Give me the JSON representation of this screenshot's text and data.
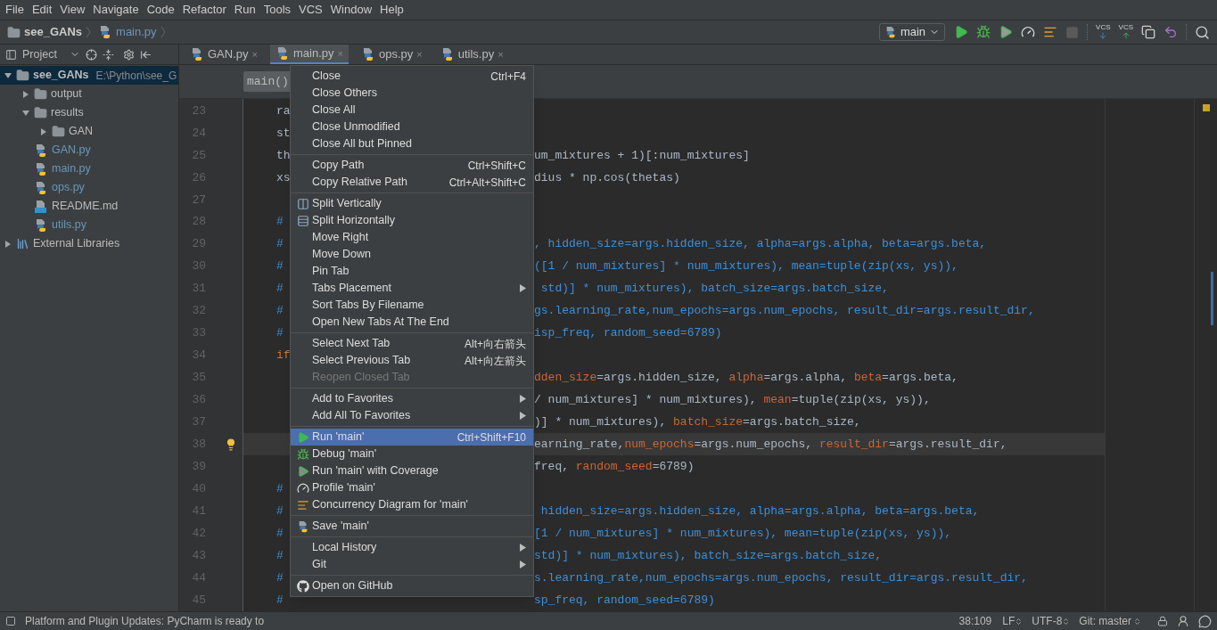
{
  "menu_bar": [
    "File",
    "Edit",
    "View",
    "Navigate",
    "Code",
    "Refactor",
    "Run",
    "Tools",
    "VCS",
    "Window",
    "Help"
  ],
  "breadcrumb": [
    {
      "label": "see_GANs",
      "kind": "folder"
    },
    {
      "label": "main.py",
      "kind": "python"
    }
  ],
  "toolbar": {
    "run_config": "main",
    "vcs_update_label": "VCS",
    "vcs_commit_label": "VCS",
    "stop_disabled": true
  },
  "project_panel": {
    "title": "Project",
    "tree": [
      {
        "label": "see_GANs",
        "path": "E:\\Python\\see_G",
        "kind": "folder",
        "expanded": true,
        "selected": true,
        "children": [
          {
            "label": "output",
            "kind": "folder",
            "expanded": false,
            "selected": false
          },
          {
            "label": "results",
            "kind": "folder",
            "expanded": true,
            "selected": false,
            "children": [
              {
                "label": "GAN",
                "kind": "folder",
                "expanded": false,
                "selected": false
              }
            ]
          },
          {
            "label": "GAN.py",
            "kind": "python",
            "selected": false
          },
          {
            "label": "main.py",
            "kind": "python",
            "selected": false
          },
          {
            "label": "ops.py",
            "kind": "python",
            "selected": false
          },
          {
            "label": "README.md",
            "kind": "markdown",
            "selected": false
          },
          {
            "label": "utils.py",
            "kind": "python",
            "selected": false
          }
        ]
      },
      {
        "label": "External Libraries",
        "kind": "library",
        "expanded": false,
        "selected": false
      }
    ]
  },
  "editor_tabs": [
    {
      "label": "GAN.py",
      "close": "×",
      "selected": false
    },
    {
      "label": "main.py",
      "close": "×",
      "selected": true
    },
    {
      "label": "ops.py",
      "close": "×",
      "selected": false
    },
    {
      "label": "utils.py",
      "close": "×",
      "selected": false
    }
  ],
  "editor_breadcrumb": "main()",
  "code_lines": [
    {
      "number": "23",
      "left": "ra",
      "kind": "code",
      "current": false
    },
    {
      "number": "24",
      "left": "st",
      "kind": "code",
      "current": false
    },
    {
      "number": "25",
      "left": "th",
      "kind": "code",
      "current": false,
      "right": [
        {
          "text": "um_mixtures + 1)[:num_mixtures]",
          "kind": "plain"
        }
      ]
    },
    {
      "number": "26",
      "left": "xs",
      "kind": "code",
      "current": false,
      "right": [
        {
          "text": "dius * np.cos(thetas)",
          "kind": "plain"
        }
      ]
    },
    {
      "number": "27",
      "kind": "code",
      "current": false
    },
    {
      "number": "28",
      "left": "#",
      "kind": "comment",
      "current": false
    },
    {
      "number": "29",
      "left": "#",
      "kind": "comment",
      "current": false,
      "right": [
        {
          "text": ", hidden_size=args.hidden_size, alpha=args.alpha, beta=args.beta,"
        }
      ]
    },
    {
      "number": "30",
      "left": "#",
      "kind": "comment",
      "current": false,
      "right": [
        {
          "text": "([1 / num_mixtures] * num_mixtures), mean=tuple(zip(xs, ys)),"
        }
      ]
    },
    {
      "number": "31",
      "left": "#",
      "kind": "comment",
      "current": false,
      "right": [
        {
          "text": " std)] * num_mixtures), batch_size=args.batch_size,"
        }
      ]
    },
    {
      "number": "32",
      "left": "#",
      "kind": "comment",
      "current": false,
      "right": [
        {
          "text": "gs.learning_rate,num_epochs=args.num_epochs, result_dir=args.result_dir,"
        }
      ]
    },
    {
      "number": "33",
      "left": "#",
      "kind": "comment",
      "current": false,
      "right": [
        {
          "text": "isp_freq, random_seed=6789)"
        }
      ]
    },
    {
      "number": "34",
      "left": "if",
      "kind": "keyword",
      "current": false
    },
    {
      "number": "35",
      "kind": "code",
      "current": false,
      "right": [
        {
          "text": "dden_size",
          "kind": "param"
        },
        {
          "text": "=args.hidden_size, ",
          "kind": "plain"
        },
        {
          "text": "alpha",
          "kind": "param"
        },
        {
          "text": "=args.alpha, ",
          "kind": "plain"
        },
        {
          "text": "beta",
          "kind": "param"
        },
        {
          "text": "=args.beta,",
          "kind": "plain"
        }
      ]
    },
    {
      "number": "36",
      "kind": "code",
      "current": false,
      "right": [
        {
          "text": "/ num_mixtures] * num_mixtures), ",
          "kind": "plain"
        },
        {
          "text": "mean",
          "kind": "param"
        },
        {
          "text": "=tuple(zip(xs, ys)),",
          "kind": "plain"
        }
      ]
    },
    {
      "number": "37",
      "kind": "code",
      "current": false,
      "right": [
        {
          "text": ")] * num_mixtures), ",
          "kind": "plain"
        },
        {
          "text": "batch_size",
          "kind": "param"
        },
        {
          "text": "=args.batch_size,",
          "kind": "plain"
        }
      ]
    },
    {
      "number": "38",
      "kind": "code",
      "current": true,
      "right": [
        {
          "text": "earning_rate,",
          "kind": "plain"
        },
        {
          "text": "num_epochs",
          "kind": "param"
        },
        {
          "text": "=args.num_epochs, ",
          "kind": "plain"
        },
        {
          "text": "result_dir",
          "kind": "param"
        },
        {
          "text": "=args.result_dir,",
          "kind": "plain"
        }
      ]
    },
    {
      "number": "39",
      "kind": "code",
      "current": false,
      "right": [
        {
          "text": "freq, ",
          "kind": "plain"
        },
        {
          "text": "random_seed",
          "kind": "param"
        },
        {
          "text": "=6789)",
          "kind": "plain"
        }
      ]
    },
    {
      "number": "40",
      "left": "#",
      "kind": "comment",
      "current": false
    },
    {
      "number": "41",
      "left": "#",
      "kind": "comment",
      "current": false,
      "right": [
        {
          "text": " hidden_size=args.hidden_size, alpha=args.alpha, beta=args.beta,"
        }
      ]
    },
    {
      "number": "42",
      "left": "#",
      "kind": "comment",
      "current": false,
      "right": [
        {
          "text": "[1 / num_mixtures] * num_mixtures), mean=tuple(zip(xs, ys)),"
        }
      ]
    },
    {
      "number": "43",
      "left": "#",
      "kind": "comment",
      "current": false,
      "right": [
        {
          "text": "std)] * num_mixtures), batch_size=args.batch_size,"
        }
      ]
    },
    {
      "number": "44",
      "left": "#",
      "kind": "comment",
      "current": false,
      "right": [
        {
          "text": "s.learning_rate,num_epochs=args.num_epochs, result_dir=args.result_dir,"
        }
      ]
    },
    {
      "number": "45",
      "left": "#",
      "kind": "comment",
      "current": false,
      "right": [
        {
          "text": "sp_freq, random_seed=6789)"
        }
      ]
    }
  ],
  "context_menu": [
    {
      "kind": "item",
      "label": "Close",
      "shortcut": "Ctrl+F4",
      "submenu": false,
      "disabled": false,
      "selected": false
    },
    {
      "kind": "item",
      "label": "Close Others",
      "submenu": false,
      "disabled": false,
      "selected": false
    },
    {
      "kind": "item",
      "label": "Close All",
      "submenu": false,
      "disabled": false,
      "selected": false
    },
    {
      "kind": "item",
      "label": "Close Unmodified",
      "submenu": false,
      "disabled": false,
      "selected": false
    },
    {
      "kind": "item",
      "label": "Close All but Pinned",
      "submenu": false,
      "disabled": false,
      "selected": false
    },
    {
      "kind": "separator"
    },
    {
      "kind": "item",
      "label": "Copy Path",
      "shortcut": "Ctrl+Shift+C",
      "submenu": false,
      "disabled": false,
      "selected": false
    },
    {
      "kind": "item",
      "label": "Copy Relative Path",
      "shortcut": "Ctrl+Alt+Shift+C",
      "submenu": false,
      "disabled": false,
      "selected": false
    },
    {
      "kind": "separator"
    },
    {
      "kind": "splitvertical",
      "label": "Split Vertically",
      "submenu": false,
      "disabled": false,
      "selected": false
    },
    {
      "kind": "splithorizontal",
      "label": "Split Horizontally",
      "submenu": false,
      "disabled": false,
      "selected": false
    },
    {
      "kind": "item",
      "label": "Move Right",
      "submenu": false,
      "disabled": false,
      "selected": false
    },
    {
      "kind": "item",
      "label": "Move Down",
      "submenu": false,
      "disabled": false,
      "selected": false
    },
    {
      "kind": "item",
      "label": "Pin Tab",
      "submenu": false,
      "disabled": false,
      "selected": false
    },
    {
      "kind": "item",
      "label": "Tabs Placement",
      "submenu": true,
      "disabled": false,
      "selected": false
    },
    {
      "kind": "item",
      "label": "Sort Tabs By Filename",
      "submenu": false,
      "disabled": false,
      "selected": false
    },
    {
      "kind": "item",
      "label": "Open New Tabs At The End",
      "submenu": false,
      "disabled": false,
      "selected": false
    },
    {
      "kind": "separator"
    },
    {
      "kind": "item",
      "label": "Select Next Tab",
      "shortcut": "Alt+向右箭头",
      "submenu": false,
      "disabled": false,
      "selected": false
    },
    {
      "kind": "item",
      "label": "Select Previous Tab",
      "shortcut": "Alt+向左箭头",
      "submenu": false,
      "disabled": false,
      "selected": false
    },
    {
      "kind": "item",
      "label": "Reopen Closed Tab",
      "submenu": false,
      "disabled": true,
      "selected": false
    },
    {
      "kind": "separator"
    },
    {
      "kind": "item",
      "label": "Add to Favorites",
      "submenu": true,
      "disabled": false,
      "selected": false
    },
    {
      "kind": "item",
      "label": "Add All To Favorites",
      "submenu": true,
      "disabled": false,
      "selected": false
    },
    {
      "kind": "separator"
    },
    {
      "kind": "run",
      "label": "Run 'main'",
      "shortcut": "Ctrl+Shift+F10",
      "submenu": false,
      "disabled": false,
      "selected": true
    },
    {
      "kind": "debug",
      "label": "Debug 'main'",
      "submenu": false,
      "disabled": false,
      "selected": false
    },
    {
      "kind": "coverage",
      "label": "Run 'main' with Coverage",
      "submenu": false,
      "disabled": false,
      "selected": false
    },
    {
      "kind": "profile",
      "label": "Profile 'main'",
      "submenu": false,
      "disabled": false,
      "selected": false
    },
    {
      "kind": "concurrency",
      "label": "Concurrency Diagram for  'main'",
      "submenu": false,
      "disabled": false,
      "selected": false
    },
    {
      "kind": "separator"
    },
    {
      "kind": "save",
      "label": "Save 'main'",
      "submenu": false,
      "disabled": false,
      "selected": false
    },
    {
      "kind": "separator"
    },
    {
      "kind": "item",
      "label": "Local History",
      "submenu": true,
      "disabled": false,
      "selected": false
    },
    {
      "kind": "item",
      "label": "Git",
      "submenu": true,
      "disabled": false,
      "selected": false
    },
    {
      "kind": "separator"
    },
    {
      "kind": "github",
      "label": "Open on GitHub",
      "submenu": false,
      "disabled": false,
      "selected": false
    }
  ],
  "status_bar": {
    "message": "Platform and Plugin Updates: PyCharm is ready to",
    "position": "38:109",
    "line_separator": "LF",
    "encoding": "UTF-8",
    "branch": "Git: master"
  }
}
